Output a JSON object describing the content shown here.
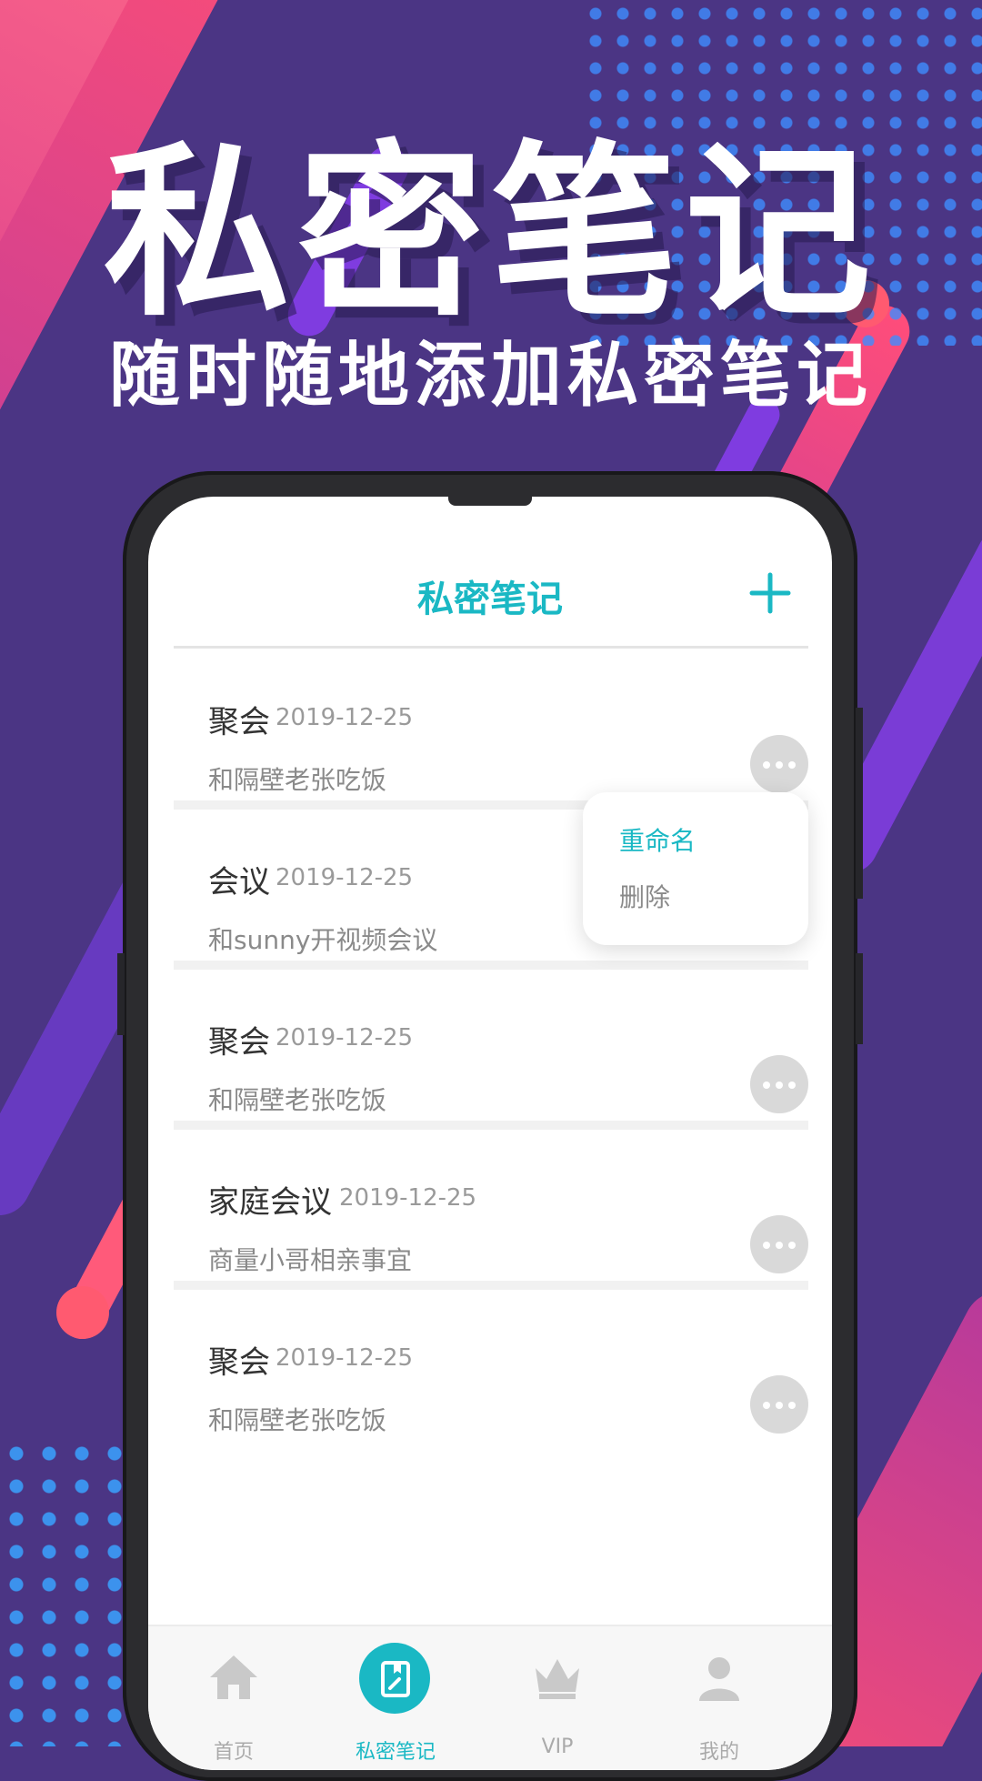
{
  "promo": {
    "title": "私密笔记",
    "subtitle": "随时随地添加私密笔记"
  },
  "app": {
    "header": {
      "title": "私密笔记",
      "add_icon": "plus-icon"
    },
    "notes": [
      {
        "title": "聚会",
        "date": "2019-12-25",
        "desc": "和隔壁老张吃饭"
      },
      {
        "title": "会议",
        "date": "2019-12-25",
        "desc": "和sunny开视频会议"
      },
      {
        "title": "聚会",
        "date": "2019-12-25",
        "desc": "和隔壁老张吃饭"
      },
      {
        "title": "家庭会议",
        "date": "2019-12-25",
        "desc": "商量小哥相亲事宜"
      },
      {
        "title": "聚会",
        "date": "2019-12-25",
        "desc": "和隔壁老张吃饭"
      }
    ],
    "context_menu": {
      "rename": "重命名",
      "delete": "删除"
    },
    "tabs": [
      {
        "label": "首页",
        "icon": "home-icon"
      },
      {
        "label": "私密笔记",
        "icon": "note-icon",
        "active": true
      },
      {
        "label": "VIP",
        "icon": "crown-icon"
      },
      {
        "label": "我的",
        "icon": "user-icon"
      }
    ]
  },
  "colors": {
    "accent": "#1ab8c4",
    "background": "#4b3584",
    "pink": "#ff4d7a"
  }
}
